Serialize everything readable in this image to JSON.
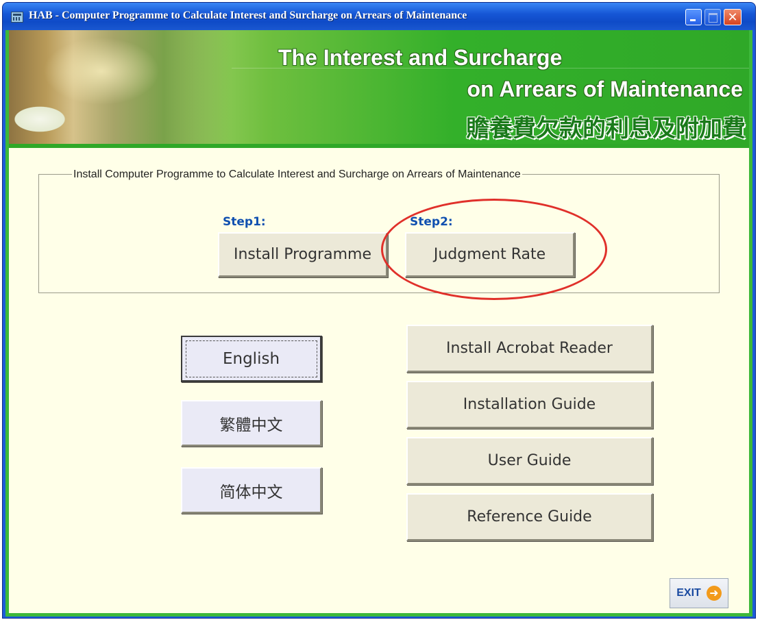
{
  "window": {
    "title": "HAB - Computer Programme to Calculate Interest and Surcharge on Arrears of Maintenance"
  },
  "banner": {
    "line1": "The Interest and Surcharge",
    "line2": "on Arrears of Maintenance",
    "line3": "贍養費欠款的利息及附加費"
  },
  "install_group": {
    "legend": "Install Computer Programme to Calculate Interest and Surcharge on Arrears of Maintenance",
    "step1_label": "Step1:",
    "step1_button": "Install Programme",
    "step2_label": "Step2:",
    "step2_button": "Judgment Rate"
  },
  "languages": {
    "english": "English",
    "traditional_chinese": "繁體中文",
    "simplified_chinese": "简体中文"
  },
  "guides": {
    "acrobat": "Install Acrobat Reader",
    "installation": "Installation Guide",
    "user": "User Guide",
    "reference": "Reference Guide"
  },
  "exit": {
    "label": "EXIT",
    "icon": "arrow-right-circle-icon"
  },
  "colors": {
    "titlebar": "#1657d6",
    "banner_green": "#33b02a",
    "background": "#ffffe8",
    "step_blue": "#1050b0",
    "highlight_red": "#e0302a"
  }
}
